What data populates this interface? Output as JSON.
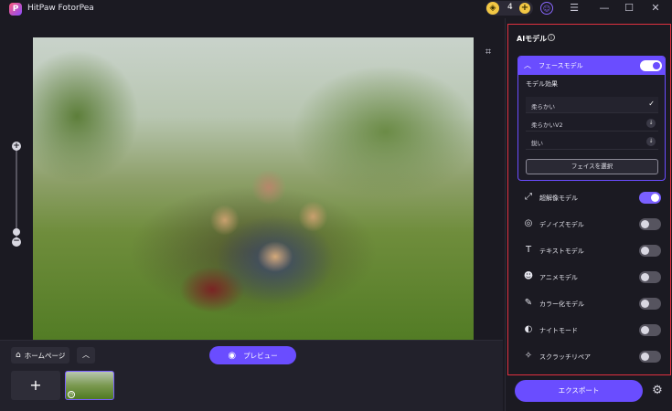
{
  "app": {
    "title": "HitPaw FotorPea",
    "logo_letter": "P",
    "credits": "4",
    "credit_plus": "+"
  },
  "window_controls": {
    "user_icon": "user-icon",
    "menu_icon": "menu-icon",
    "minimize_icon": "minimize-icon",
    "maximize_icon": "maximize-icon",
    "close_icon": "close-icon"
  },
  "canvas": {
    "zoom_in_label": "+",
    "zoom_out_label": "−",
    "crop_icon": "crop-icon"
  },
  "bottom": {
    "home_label": "ホームページ",
    "preview_label": "プレビュー",
    "add_label": "+"
  },
  "panel": {
    "title": "AIモデル",
    "face_model": {
      "title": "フェースモデル",
      "enabled": true,
      "effect_label": "モデル効果",
      "options": [
        {
          "label": "柔らかい",
          "selected": true
        },
        {
          "label": "柔らかいV2",
          "selected": false
        },
        {
          "label": "鋭い",
          "selected": false
        }
      ],
      "select_face_label": "フェイスを選択"
    },
    "models": [
      {
        "label": "超解像モデル",
        "icon": "upscale-icon",
        "enabled": true
      },
      {
        "label": "デノイズモデル",
        "icon": "denoise-icon",
        "enabled": false
      },
      {
        "label": "テキストモデル",
        "icon": "text-icon",
        "enabled": false
      },
      {
        "label": "アニメモデル",
        "icon": "anime-icon",
        "enabled": false
      },
      {
        "label": "カラー化モデル",
        "icon": "colorize-icon",
        "enabled": false
      },
      {
        "label": "ナイトモード",
        "icon": "night-mode-icon",
        "enabled": false
      },
      {
        "label": "スクラッチリペア",
        "icon": "scratch-repair-icon",
        "enabled": false
      }
    ],
    "export_label": "エクスポート"
  },
  "colors": {
    "accent": "#6a4dff",
    "background": "#1b1a22",
    "highlight_frame": "#e0313f",
    "credit_gold": "#f2c744"
  }
}
